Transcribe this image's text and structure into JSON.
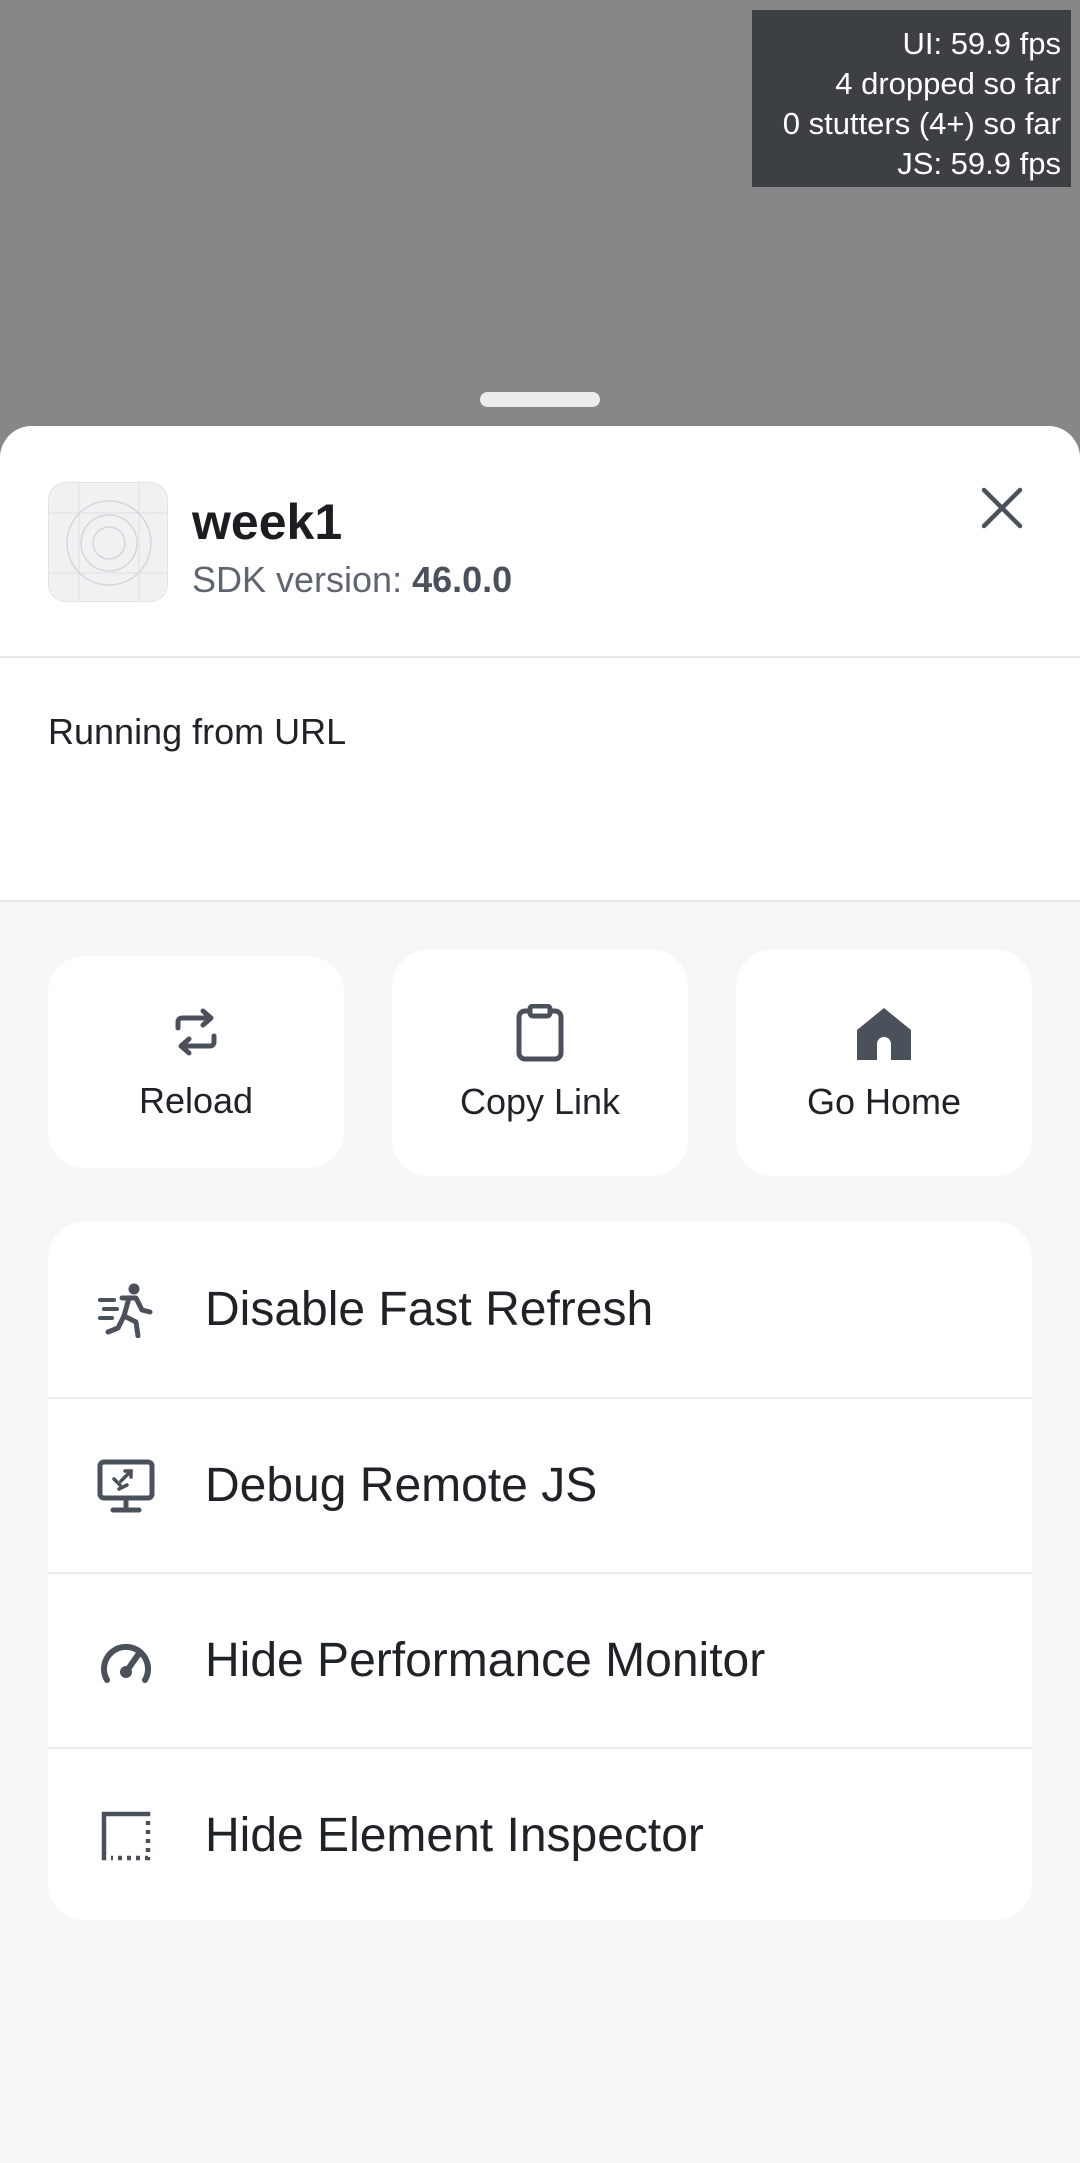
{
  "perf_monitor": {
    "ui_fps": "UI: 59.9 fps",
    "dropped": "4 dropped so far",
    "stutters": "0 stutters (4+) so far",
    "js_fps": "JS: 59.9 fps"
  },
  "app": {
    "name": "week1",
    "sdk_label": "SDK version: ",
    "sdk_version": "46.0.0"
  },
  "status": {
    "running_from": "Running from URL"
  },
  "quick_actions": [
    {
      "label": "Reload",
      "icon": "reload-icon"
    },
    {
      "label": "Copy Link",
      "icon": "clipboard-icon"
    },
    {
      "label": "Go Home",
      "icon": "home-icon"
    }
  ],
  "menu": [
    {
      "label": "Disable Fast Refresh",
      "icon": "running-person-icon"
    },
    {
      "label": "Debug Remote JS",
      "icon": "remote-debug-icon"
    },
    {
      "label": "Hide Performance Monitor",
      "icon": "speedometer-icon"
    },
    {
      "label": "Hide Element Inspector",
      "icon": "inspector-icon"
    }
  ],
  "colors": {
    "backdrop": "#878787",
    "sheet_background": "#f6f7f9",
    "card": "#ffffff",
    "icon": "#4b515b",
    "text": "#1f2226",
    "perf_background": "#3c3f44"
  }
}
